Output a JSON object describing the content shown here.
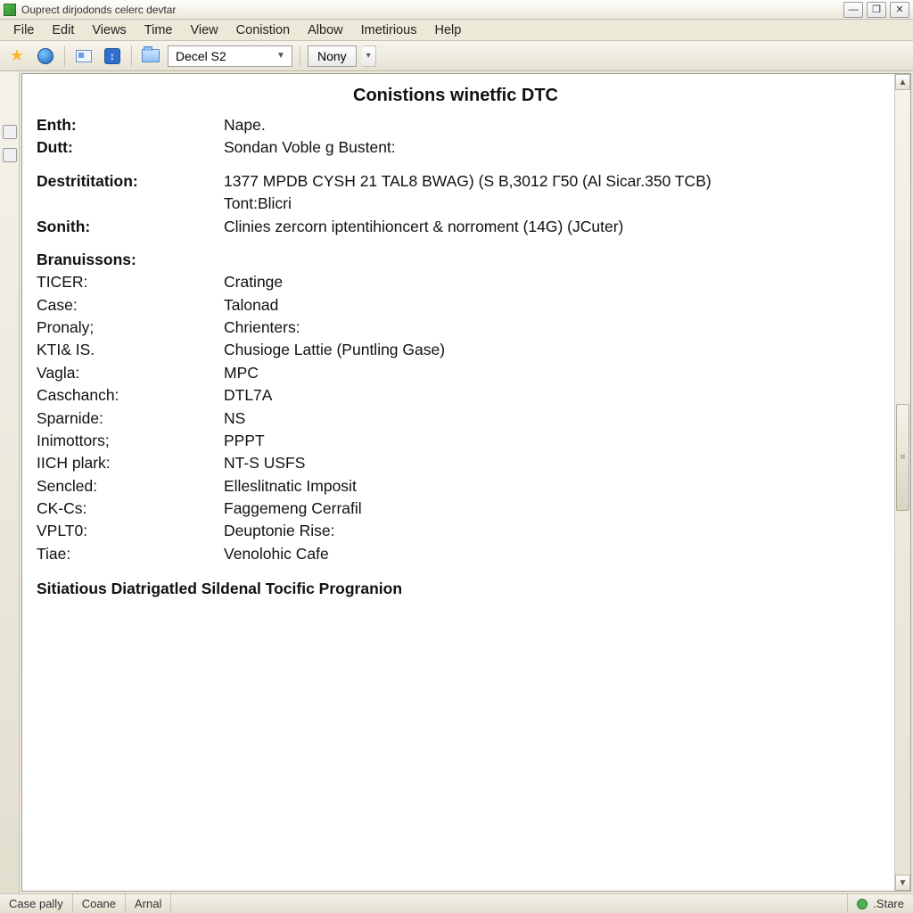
{
  "window": {
    "title": "Ouprect dirjodonds celerc devtar"
  },
  "menubar": {
    "items": [
      "File",
      "Edit",
      "Views",
      "Time",
      "View",
      "Conistion",
      "Albow",
      "Imetirious",
      "Help"
    ]
  },
  "toolbar": {
    "combo_value": "Decel S2",
    "nony_label": "Nony"
  },
  "document": {
    "title": "Conistions  winetfic  DTC",
    "header_rows": [
      {
        "label": "Enth:",
        "value": "Nape.",
        "bold": true
      },
      {
        "label": "Dutt:",
        "value": "Sondan Voble g Bustent:",
        "bold": true
      }
    ],
    "info_rows": [
      {
        "label": "Destrititation:",
        "value": "1377 MPDB CYSH 21 TAL8 BWAG) (S B,3012 Г50 (Al Sicar.350 TCB)",
        "bold": true
      },
      {
        "label": "",
        "value": "Tont:Blicri",
        "bold": false
      },
      {
        "label": "Sonith:",
        "value": "Clinies zercorn iptentihioncert & norroment (14G) (JCuter)",
        "bold": true
      }
    ],
    "branuissons_label": "Branuissons:",
    "branuissons": [
      {
        "label": "TICER:",
        "value": "Cratinge"
      },
      {
        "label": "Case:",
        "value": "Talonad"
      },
      {
        "label": "Pronaly;",
        "value": "Chrienters:"
      },
      {
        "label": "KTI& IS.",
        "value": "Chusioge Lattie (Puntling Gase)"
      },
      {
        "label": "Vagla:",
        "value": "MPC"
      },
      {
        "label": "Caschanch:",
        "value": "DTL7A"
      },
      {
        "label": "Sparnide:",
        "value": "NS"
      },
      {
        "label": "Inimottors;",
        "value": "PPPT"
      },
      {
        "label": "IICH plark:",
        "value": "NT-S USFS"
      },
      {
        "label": "Sencled:",
        "value": "Elleslitnatic Imposit"
      },
      {
        "label": "CK-Cs:",
        "value": "Faggemeng Cerrafil"
      },
      {
        "label": "VPLT0:",
        "value": "Deuptonie Rise:"
      },
      {
        "label": "Tiae:",
        "value": "Venolohic Cafe"
      }
    ],
    "footer_heading": "Sitiatious Diatrigatled Sildenal Tocific Progranion"
  },
  "statusbar": {
    "cell1": "Case pally",
    "cell2": "Coane",
    "cell3": "Arnal",
    "start_label": ".Stare"
  }
}
